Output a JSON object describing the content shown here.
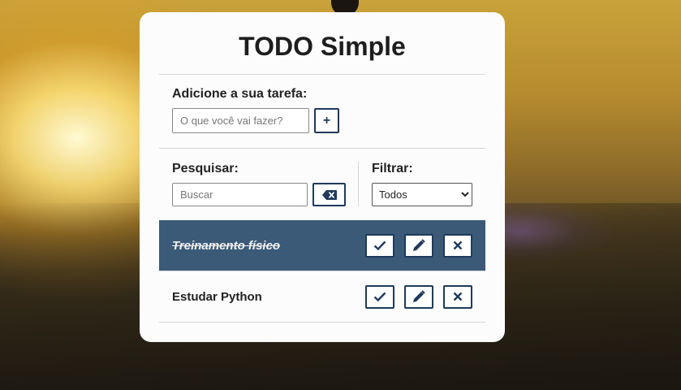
{
  "app": {
    "title": "TODO Simple"
  },
  "add_form": {
    "label": "Adicione a sua tarefa:",
    "placeholder": "O que você vai fazer?",
    "value": "",
    "add_button_label": "+"
  },
  "search": {
    "label": "Pesquisar:",
    "placeholder": "Buscar",
    "value": "",
    "clear_icon": "backspace-icon"
  },
  "filter": {
    "label": "Filtrar:",
    "selected": "Todos"
  },
  "todos": [
    {
      "text": "Treinamento físico",
      "done": true
    },
    {
      "text": "Estudar Python",
      "done": false
    }
  ],
  "icons": {
    "finish": "check-icon",
    "edit": "pencil-icon",
    "remove": "close-icon"
  },
  "colors": {
    "accent": "#1f3a5c",
    "done_row": "#3b5a78",
    "card": "#fcfcfc"
  }
}
